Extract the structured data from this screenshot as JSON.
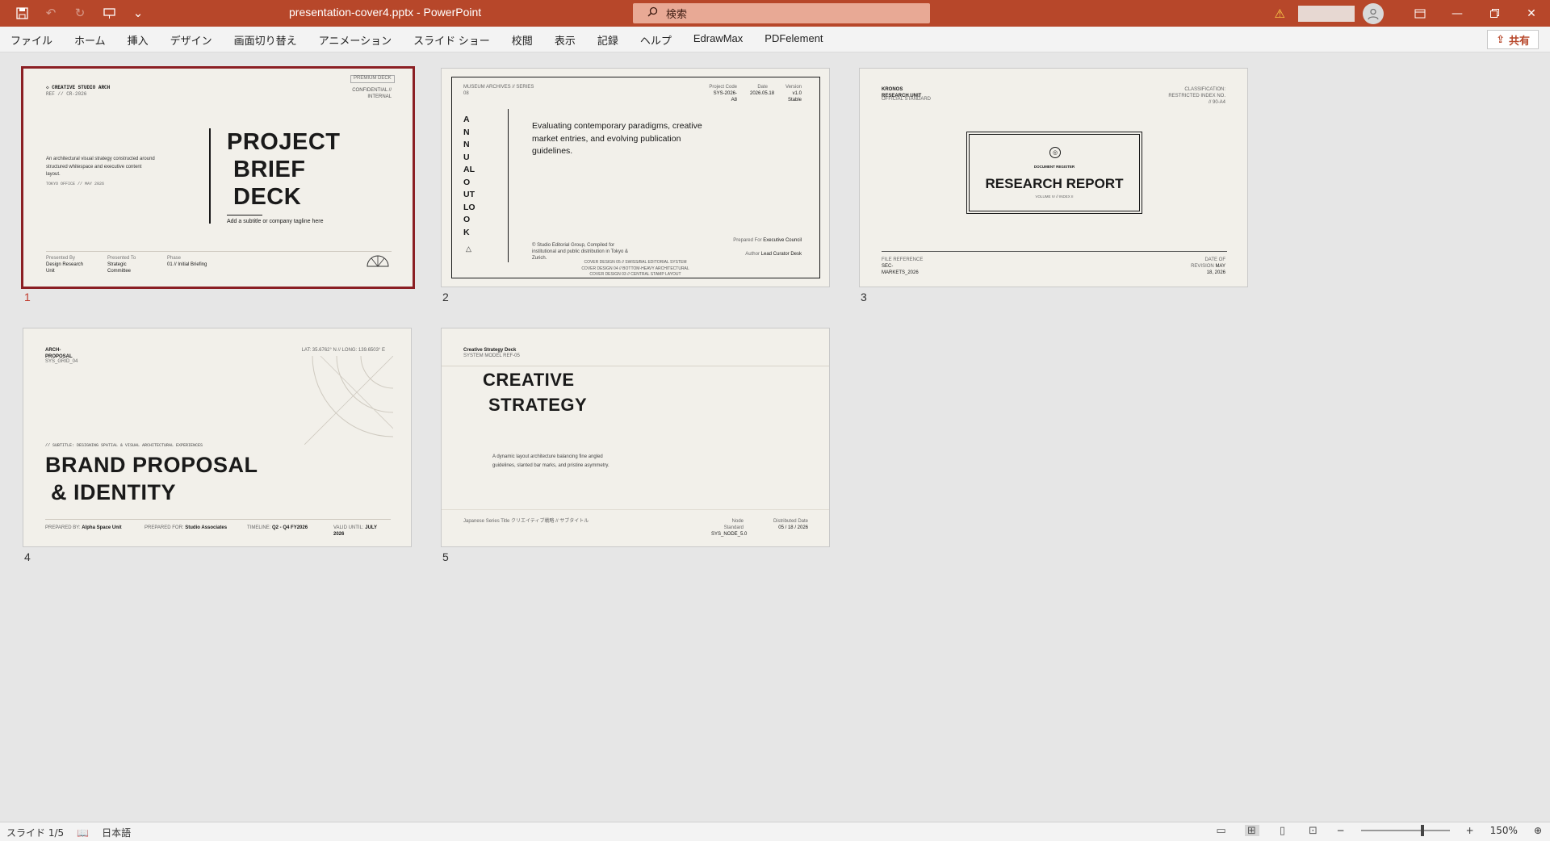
{
  "window": {
    "file_title": "presentation-cover4.pptx",
    "app_name": "PowerPoint",
    "title_sep": " - ",
    "search_placeholder": "検索",
    "accent": "#b7472a"
  },
  "ribbon": {
    "tabs": [
      "ファイル",
      "ホーム",
      "挿入",
      "デザイン",
      "画面切り替え",
      "アニメーション",
      "スライド ショー",
      "校閲",
      "表示",
      "記録",
      "ヘルプ",
      "EdrawMax",
      "PDFelement"
    ],
    "share_label": "共有"
  },
  "slides": [
    {
      "number": "1",
      "brand": "CREATIVE STUDIO ARCH",
      "ref": "REF // CR-2026",
      "confidential": "CONFIDENTIAL // INTERNAL",
      "corner_tag": "PREMIUM DECK",
      "title_lines": [
        "PROJECT",
        "BRIEF",
        "DECK"
      ],
      "subtitle": "Add a subtitle or company tagline here",
      "description": "An architectural visual strategy constructed around structured whitespace and executive content layout.",
      "location": "TOKYO OFFICE // MAY 2026",
      "footer": [
        {
          "label": "Presented By",
          "value": "Design Research Unit"
        },
        {
          "label": "Presented To",
          "value": "Strategic Committee"
        },
        {
          "label": "Phase",
          "value": "01 // Initial Briefing"
        }
      ]
    },
    {
      "number": "2",
      "series": "MUSEUM ARCHIVES // SERIES 08",
      "meta": [
        {
          "label": "Project Code",
          "value": "SYS-2026-A8"
        },
        {
          "label": "Date",
          "value": "2026.05.18"
        },
        {
          "label": "Version",
          "value": "v1.0 Stable"
        }
      ],
      "vertical_title": [
        "A",
        "N",
        "N",
        "U",
        "AL",
        "O",
        "UT",
        "LO",
        "O",
        "K"
      ],
      "intro": "Evaluating contemporary paradigms, creative market entries, and evolving publication guidelines.",
      "copyright": "© Studio Editorial Group, Compiled for institutional and public distribution in Tokyo & Zurich.",
      "prepared_for_label": "Prepared For",
      "prepared_for": "Executive Council",
      "author_label": "Author",
      "author": "Lead Curator Desk",
      "cover_lines": [
        "COVER DESIGN 05 // SWISS/BAL EDITORIAL SYSTEM",
        "COVER DESIGN 04 // BOTTOM-HEAVY ARCHITECTURAL",
        "COVER DESIGN 03 // CENTRAL STAMP LAYOUT"
      ]
    },
    {
      "number": "3",
      "org": "KRONOS RESEARCH UNIT",
      "org_tag": "OFFICIAL STANDARD",
      "classification": "CLASSIFICATION: RESTRICTED INDEX NO. // 90-A4",
      "stamp_label": "DOCUMENT REGISTER",
      "title": "RESEARCH REPORT",
      "volume": "VOLUME IV // INDEX II",
      "file_ref_label": "FILE REFERENCE",
      "file_ref": "SEC-MARKETS_2026",
      "revision_label": "DATE OF REVISION",
      "revision": "MAY 18, 2026"
    },
    {
      "number": "4",
      "code": "ARCH-PROPOSAL",
      "grid": "SYS_GRID_04",
      "coords": "LAT: 35.6762° N // LONG: 139.6503° E",
      "subtitle": "// SUBTITLE: DESIGNING SPATIAL & VISUAL ARCHITECTURAL EXPERIENCES",
      "title_lines": [
        "BRAND PROPOSAL",
        "& IDENTITY"
      ],
      "footer": [
        {
          "label": "PREPARED BY:",
          "value": "Alpha Space Unit"
        },
        {
          "label": "PREPARED FOR:",
          "value": "Studio Associates"
        },
        {
          "label": "TIMELINE:",
          "value": "Q2 - Q4 FY2026"
        },
        {
          "label": "VALID UNTIL:",
          "value": "JULY 2026"
        }
      ]
    },
    {
      "number": "5",
      "deck": "Creative Strategy Deck",
      "model": "SYSTEM MODEL REF-05",
      "title_lines": [
        "CREATIVE",
        "STRATEGY"
      ],
      "description": "A dynamic layout architecture balancing fine angled guidelines, slanted bar marks, and pristine asymmetry.",
      "series_title": "Japanese Series Title クリエイティブ戦略 // サブタイトル",
      "node_label": "Node Standard",
      "node": "SYS_NODE_5.0",
      "date_label": "Distributed Date",
      "date": "05 / 18 / 2026"
    }
  ],
  "status": {
    "slide_indicator": "スライド 1/5",
    "language": "日本語",
    "zoom": "150%"
  }
}
